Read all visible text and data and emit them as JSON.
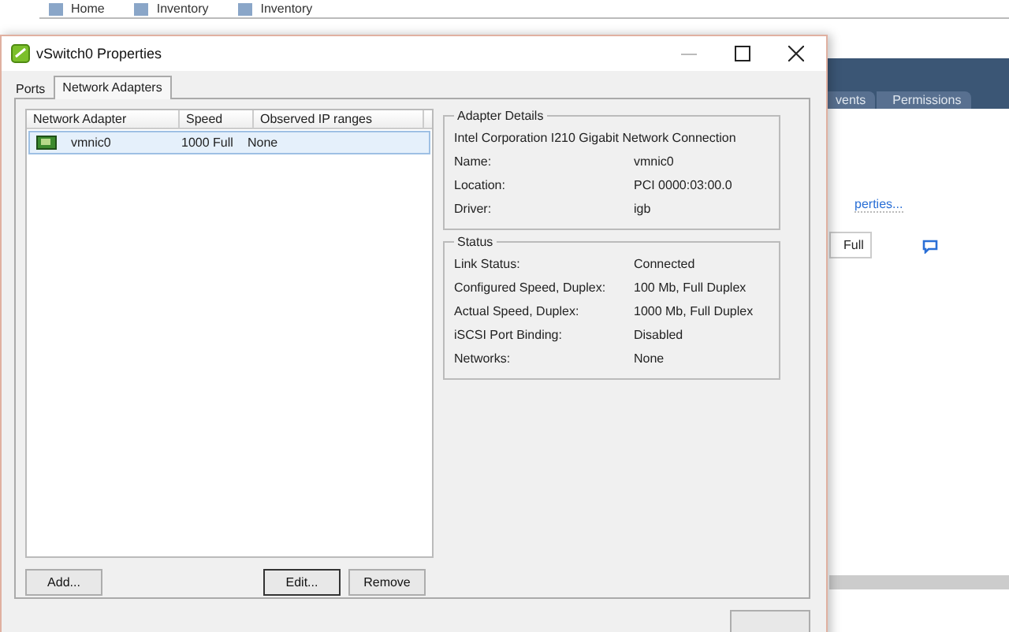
{
  "background_app": {
    "breadcrumb": [
      "Home",
      "Inventory",
      "Inventory"
    ],
    "tabs": [
      "vents",
      "Permissions"
    ],
    "link": "perties...",
    "speed_field": "Full"
  },
  "window": {
    "title": "vSwitch0 Properties"
  },
  "tabs": [
    {
      "label": "Ports",
      "selected": false
    },
    {
      "label": "Network Adapters",
      "selected": true
    }
  ],
  "adapters": {
    "columns": [
      "Network Adapter",
      "Speed",
      "Observed IP ranges"
    ],
    "rows": [
      {
        "name": "vmnic0",
        "speed": "1000 Full",
        "ip_ranges": "None",
        "selected": true
      }
    ]
  },
  "buttons": [
    {
      "label": "Add...",
      "focused": false
    },
    {
      "label": "Edit...",
      "focused": true
    },
    {
      "label": "Remove",
      "focused": false
    }
  ],
  "adapter_details": {
    "title": "Adapter Details",
    "description": "Intel Corporation I210 Gigabit Network Connection",
    "fields": [
      {
        "label": "Name:",
        "value": "vmnic0"
      },
      {
        "label": "Location:",
        "value": "PCI 0000:03:00.0"
      },
      {
        "label": "Driver:",
        "value": "igb"
      }
    ]
  },
  "status": {
    "title": "Status",
    "fields": [
      {
        "label": "Link Status:",
        "value": "Connected"
      },
      {
        "label": "Configured Speed, Duplex:",
        "value": "100 Mb, Full Duplex"
      },
      {
        "label": "Actual Speed, Duplex:",
        "value": "1000 Mb, Full Duplex"
      },
      {
        "label": "iSCSI Port Binding:",
        "value": "Disabled"
      },
      {
        "label": "Networks:",
        "value": "None"
      }
    ]
  }
}
